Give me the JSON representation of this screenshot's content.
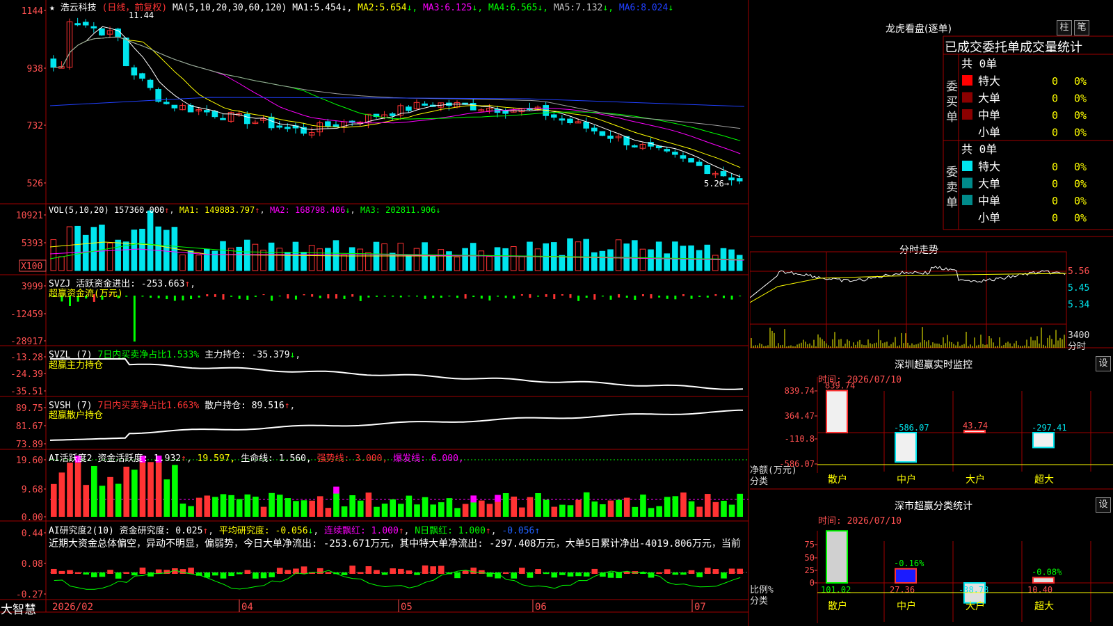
{
  "colors": {
    "up": "#ff3333",
    "down": "#00e5ee",
    "grid": "#a00000",
    "yellow": "#ffff00",
    "white": "#ffffff",
    "magenta": "#ff00ff",
    "green": "#00ff00",
    "blue": "#2040ff",
    "gray": "#a0a0a0",
    "axisText": "#ff5050"
  },
  "app": {
    "name": "大智慧",
    "date_axis_year": "2026/02",
    "months": [
      "04",
      "05",
      "06",
      "07"
    ]
  },
  "main": {
    "title": "浩云科技",
    "mode": "(日线，前复权)",
    "ma_label": "MA(5,10,20,30,60,120)",
    "ma": [
      {
        "label": "MA1:",
        "value": "5.454",
        "arrow": "↓,"
      },
      {
        "label": "MA2:",
        "value": "5.654",
        "arrow": "↓,"
      },
      {
        "label": "MA3:",
        "value": "6.125",
        "arrow": "↓,"
      },
      {
        "label": "MA4:",
        "value": "6.565",
        "arrow": "↓,"
      },
      {
        "label": "MA5:",
        "value": "7.132",
        "arrow": "↓,"
      },
      {
        "label": "MA6:",
        "value": "8.024",
        "arrow": "↓"
      }
    ],
    "yticks": [
      "1144",
      "938",
      "732",
      "526"
    ],
    "high_mark": "11.44",
    "low_mark": "5.26"
  },
  "vol": {
    "label": "VOL(5,10,20)",
    "value": "157360.000",
    "ma1": "MA1: 149883.797",
    "ma2": "MA2: 168798.406",
    "ma3": "MA3: 202811.906",
    "yticks": [
      "10921",
      "5393"
    ],
    "unit": "X100"
  },
  "svzj": {
    "label": "SVZJ",
    "desc": "活跃资金进出: -253.663",
    "sub": "超赢资金流(万元)",
    "yticks": [
      "3999",
      "-12459",
      "-28917"
    ]
  },
  "svzl": {
    "label": "SVZL (7)",
    "pct": "7日内买卖净占比1.533%",
    "desc": "主力持仓: -35.379",
    "sub": "超赢主力持仓",
    "yticks": [
      "-13.28",
      "-24.39",
      "-35.51"
    ]
  },
  "svsh": {
    "label": "SVSH (7)",
    "pct": "7日内买卖净占比1.663%",
    "desc": "散户持仓: 89.516",
    "sub": "超赢散户持仓",
    "yticks": [
      "89.75",
      "81.67",
      "73.89"
    ]
  },
  "ai1": {
    "label": "AI活跃度2",
    "desc": "资金活跃度: 1.932",
    "v2": "19.597,",
    "life": "生命线: 1.560,",
    "strong": "强势线: 3.000,",
    "burst": "爆发线: 6.000,",
    "yticks": [
      "19.60",
      "9.68",
      "0.00"
    ]
  },
  "ai2": {
    "label": "AI研究度2(10)",
    "desc": "资金研究度: 0.025",
    "avg": "平均研究度: -0.056",
    "cont": "连续飘红: 1.000",
    "n": "N日飘红: 1.000",
    "last": "-0.056",
    "text": "近期大资金总体偏空，异动不明显，偏弱势，今日大单净流出: -253.671万元，其中特大单净流出: -297.408万元，大单5日累计净出-4019.806万元，当前",
    "yticks": [
      "0.44",
      "0.08",
      "-0.27"
    ]
  },
  "lhb": {
    "title": "龙虎看盘(逐单)",
    "btn1": "柱",
    "btn2": "笔",
    "header": "已成交委托单成交量统计",
    "buy": {
      "side": "委买单",
      "total": "共 0单",
      "rows": [
        {
          "label": "特大",
          "n": "0",
          "pct": "0%",
          "color": "#ff0000"
        },
        {
          "label": "大单",
          "n": "0",
          "pct": "0%",
          "color": "#8b0000"
        },
        {
          "label": "中单",
          "n": "0",
          "pct": "0%",
          "color": "#8b0000"
        },
        {
          "label": "小单",
          "n": "0",
          "pct": "0%",
          "color": ""
        }
      ]
    },
    "sell": {
      "side": "委卖单",
      "total": "共 0单",
      "rows": [
        {
          "label": "特大",
          "n": "0",
          "pct": "0%",
          "color": "#00e5ee"
        },
        {
          "label": "大单",
          "n": "0",
          "pct": "0%",
          "color": "#008b8b"
        },
        {
          "label": "中单",
          "n": "0",
          "pct": "0%",
          "color": "#008b8b"
        },
        {
          "label": "小单",
          "n": "0",
          "pct": "0%",
          "color": ""
        }
      ]
    }
  },
  "fenshi": {
    "title": "分时走势",
    "yticks": [
      "5.56",
      "5.45",
      "5.34"
    ],
    "vol_label": "3400",
    "vol_unit": "分时"
  },
  "monitor": {
    "title": "深圳超赢实时监控",
    "btn": "设",
    "time": "时间: 2026/07/10",
    "yticks": [
      "839.74",
      "364.47",
      "-110.8",
      "-586.07"
    ],
    "ylabel": "净额(万元)",
    "xlabel": "分类",
    "cats": [
      "散户",
      "中户",
      "大户",
      "超大"
    ],
    "values": [
      839.74,
      -586.07,
      43.74,
      -297.41
    ],
    "labels": [
      "839.74",
      "-586.07",
      "43.74",
      "-297.41"
    ]
  },
  "stat": {
    "title": "深市超赢分类统计",
    "btn": "设",
    "time": "时间: 2026/07/10",
    "yticks": [
      "75",
      "50",
      "25",
      "0"
    ],
    "ylabel": "比例%",
    "xlabel": "分类",
    "cats": [
      "散户",
      "中户",
      "大户",
      "超大"
    ],
    "values": [
      101.02,
      27.36,
      -38.78,
      10.4
    ],
    "labels": [
      "101.02",
      "27.36",
      "-38.78",
      "10.40"
    ],
    "pcts": [
      "",
      "-0.16%",
      "",
      "-0.08%"
    ]
  }
}
